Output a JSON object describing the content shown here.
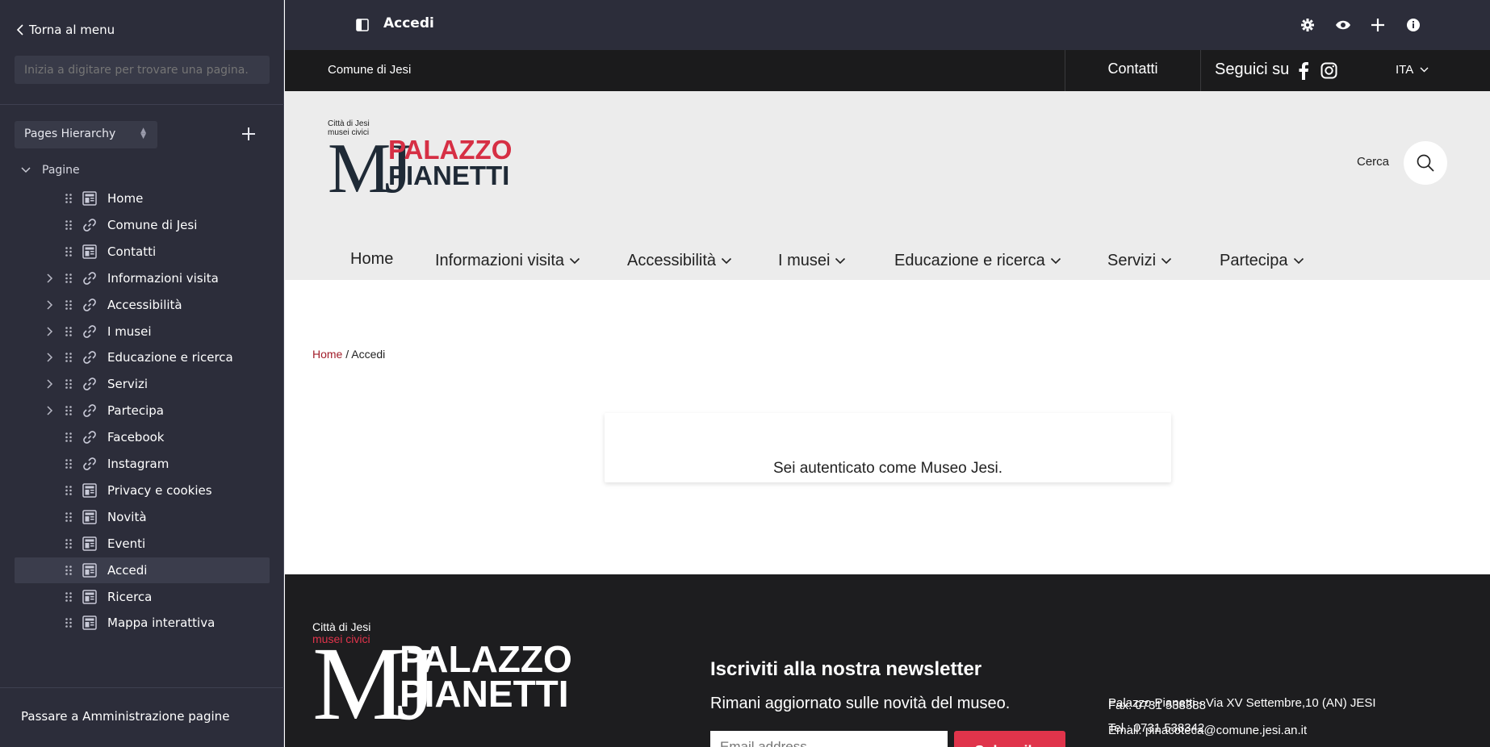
{
  "sidebar": {
    "back_label": "Torna al menu",
    "search_placeholder": "Inizia a digitare per trovare una pagina.",
    "hierarchy_select": "Pages Hierarchy",
    "root_label": "Pagine",
    "items": [
      {
        "label": "Home",
        "icon": "page-icon",
        "expandable": false
      },
      {
        "label": "Comune di Jesi",
        "icon": "link-icon",
        "expandable": false
      },
      {
        "label": "Contatti",
        "icon": "page-icon",
        "expandable": false
      },
      {
        "label": "Informazioni visita",
        "icon": "link-icon",
        "expandable": true
      },
      {
        "label": "Accessibilità",
        "icon": "link-icon",
        "expandable": true
      },
      {
        "label": "I musei",
        "icon": "link-icon",
        "expandable": true
      },
      {
        "label": "Educazione e ricerca",
        "icon": "link-icon",
        "expandable": true
      },
      {
        "label": "Servizi",
        "icon": "link-icon",
        "expandable": true
      },
      {
        "label": "Partecipa",
        "icon": "link-icon",
        "expandable": true
      },
      {
        "label": "Facebook",
        "icon": "link-icon",
        "expandable": false
      },
      {
        "label": "Instagram",
        "icon": "link-icon",
        "expandable": false
      },
      {
        "label": "Privacy e cookies",
        "icon": "page-icon",
        "expandable": false
      },
      {
        "label": "Novità",
        "icon": "page-icon",
        "expandable": false
      },
      {
        "label": "Eventi",
        "icon": "page-icon",
        "expandable": false
      },
      {
        "label": "Accedi",
        "icon": "page-icon",
        "expandable": false,
        "active": true
      },
      {
        "label": "Ricerca",
        "icon": "page-icon",
        "expandable": false
      },
      {
        "label": "Mappa interattiva",
        "icon": "page-icon",
        "expandable": false
      }
    ],
    "admin_link": "Passare a Amministrazione pagine"
  },
  "topbar": {
    "page_title": "Accedi",
    "icons": [
      "gear-icon",
      "eye-icon",
      "plus-icon",
      "info-icon"
    ]
  },
  "site": {
    "utility": {
      "comune": "Comune di Jesi",
      "contatti": "Contatti",
      "seguici": "Seguici su",
      "lang": "ITA"
    },
    "logo": {
      "small_line1": "Città di Jesi",
      "small_line2": "musei civici",
      "monogram": "MJ",
      "line1": "PALAZZO",
      "line2": "PIANETTI"
    },
    "search_label": "Cerca",
    "nav": [
      {
        "label": "Home",
        "dropdown": false
      },
      {
        "label": "Informazioni visita",
        "dropdown": true
      },
      {
        "label": "Accessibilità",
        "dropdown": true
      },
      {
        "label": "I musei",
        "dropdown": true
      },
      {
        "label": "Educazione e ricerca",
        "dropdown": true
      },
      {
        "label": "Servizi",
        "dropdown": true
      },
      {
        "label": "Partecipa",
        "dropdown": true
      }
    ],
    "breadcrumb": {
      "home": "Home",
      "separator": " / ",
      "current": "Accedi"
    },
    "auth_message": "Sei autenticato come Museo Jesi.",
    "footer": {
      "logo_line1": "Città di Jesi",
      "logo_line2": "musei civici",
      "newsletter_title": "Iscriviti alla nostra newsletter",
      "newsletter_sub": "Rimani aggiornato sulle novità del museo.",
      "email_placeholder": "Email address",
      "subscribe": "Subscribe",
      "address": "Palazzo Pianetti - Via XV Settembre,10 (AN) JESI",
      "tel": "Tel.: 0731 538342",
      "fax": "Fax: 0731 538388",
      "email": "Email: pinacoteca@comune.jesi.an.it"
    }
  },
  "colors": {
    "sidebar_bg": "#2c2d3a",
    "brand_red": "#d62f44",
    "brand_dark": "#1f2a36",
    "footer_bg": "#1d1d1f"
  }
}
